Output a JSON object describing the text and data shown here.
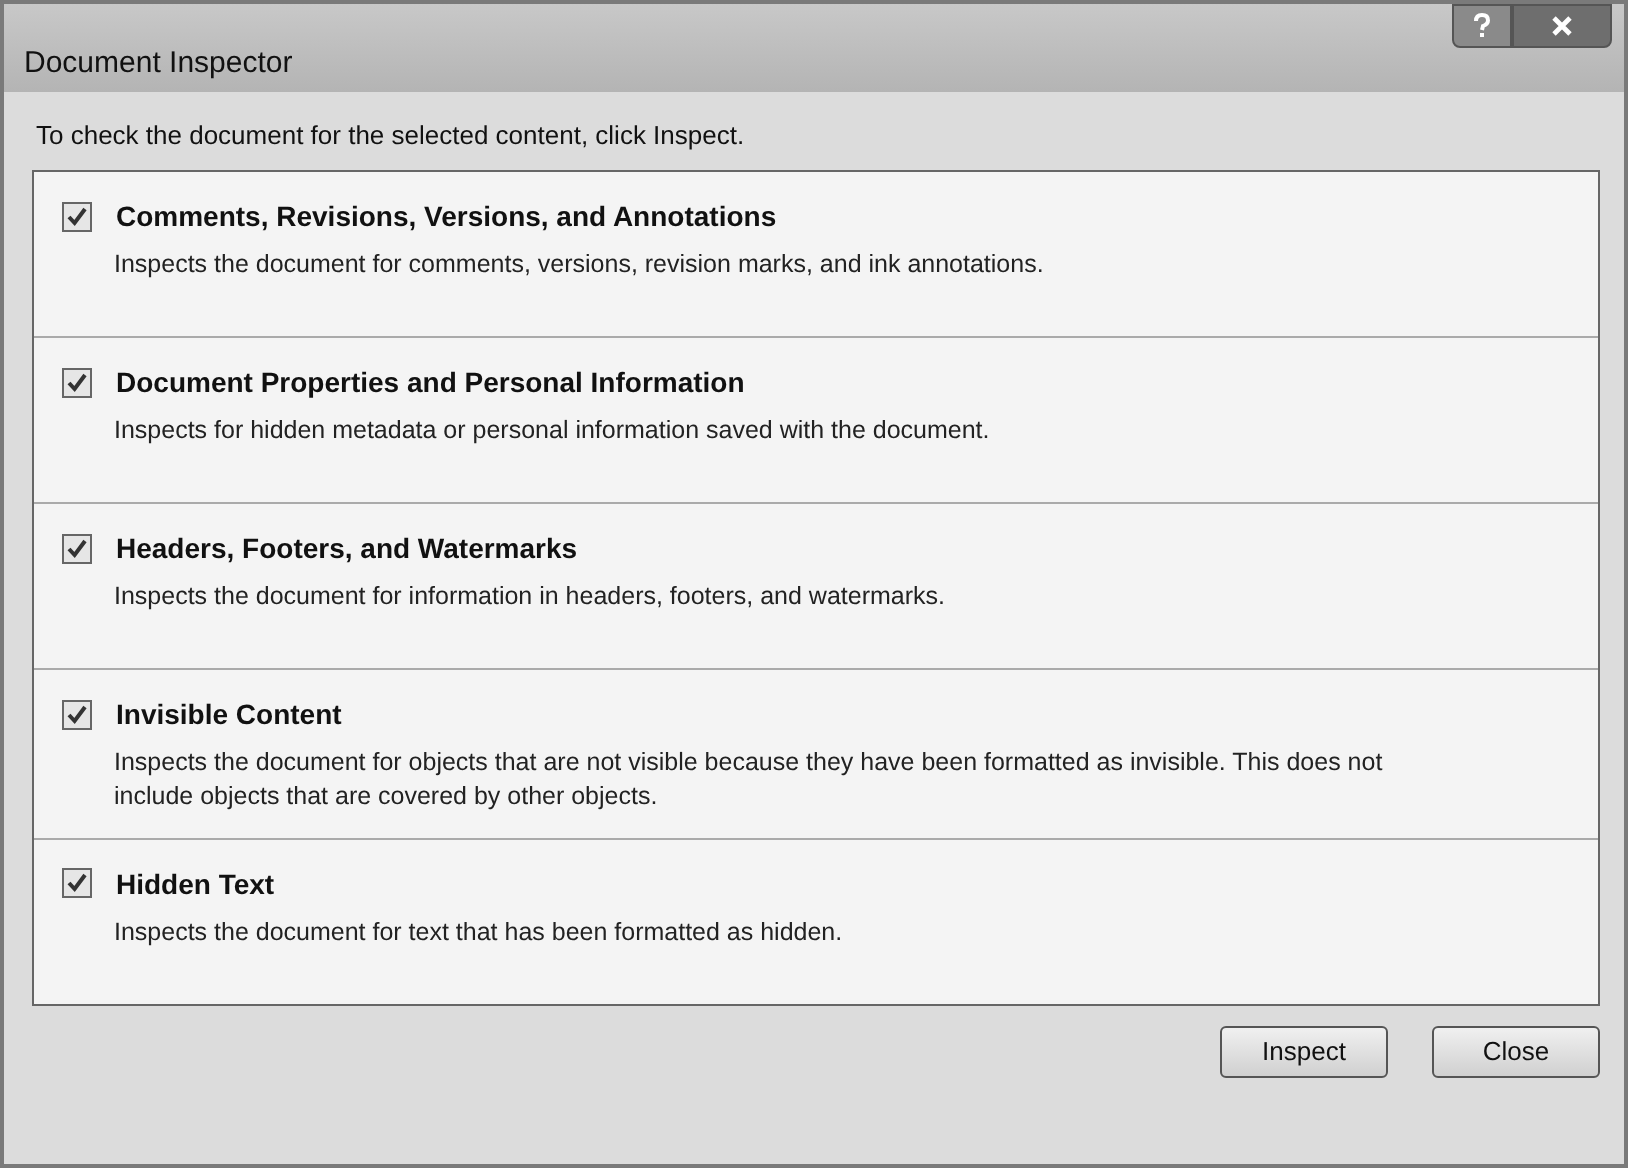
{
  "window": {
    "title": "Document Inspector"
  },
  "instruction": "To check the document for the selected content, click Inspect.",
  "items": [
    {
      "title": "Comments, Revisions, Versions, and Annotations",
      "description": "Inspects the document for comments, versions, revision marks, and ink annotations.",
      "checked": true
    },
    {
      "title": "Document Properties and Personal Information",
      "description": "Inspects for hidden metadata or personal information saved with the document.",
      "checked": true
    },
    {
      "title": "Headers, Footers, and Watermarks",
      "description": "Inspects the document for information in headers, footers, and watermarks.",
      "checked": true
    },
    {
      "title": "Invisible Content",
      "description": "Inspects the document for objects that are not visible because they have been formatted as invisible. This does not include objects that are covered by other objects.",
      "checked": true
    },
    {
      "title": "Hidden Text",
      "description": "Inspects the document for text that has been formatted as hidden.",
      "checked": true
    }
  ],
  "buttons": [
    "Inspect",
    "Close"
  ]
}
